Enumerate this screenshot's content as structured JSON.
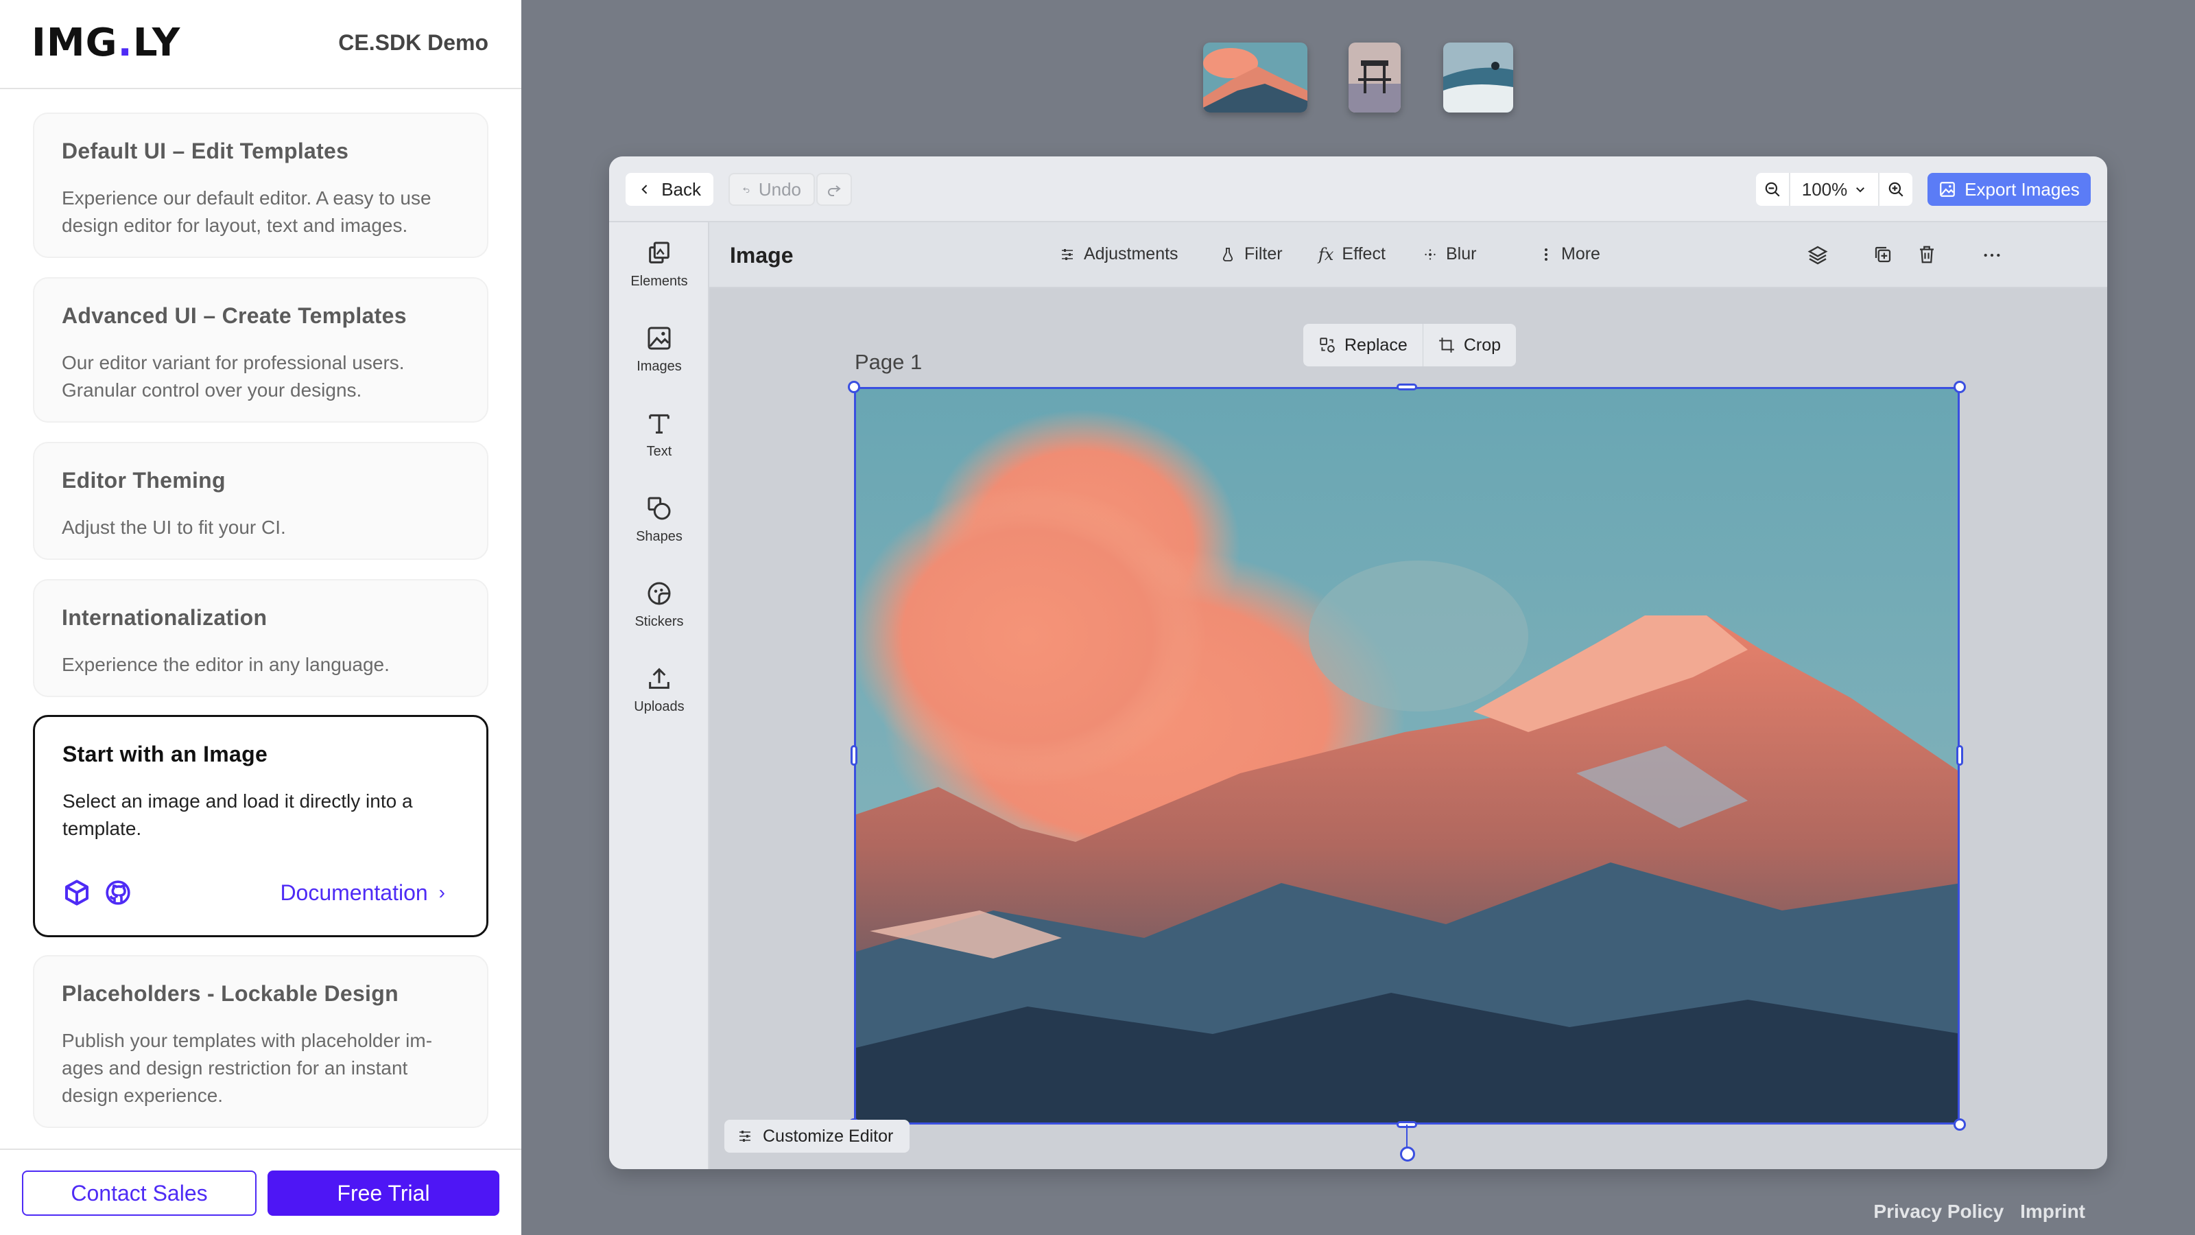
{
  "sidebar": {
    "logo": {
      "left": "IMG",
      "dot": ".",
      "right": "LY"
    },
    "demo_title": "CE.SDK Demo",
    "cards": [
      {
        "title": "Default UI – Edit Templates",
        "desc": "Experience our default editor. A easy to use design editor for layout, text and images."
      },
      {
        "title": "Advanced UI – Create Templates",
        "desc": "Our editor variant for professional users. Granular control over your designs."
      },
      {
        "title": "Editor Theming",
        "desc": "Adjust the UI to fit your CI."
      },
      {
        "title": "Internationalization",
        "desc": "Experience the editor in any language."
      },
      {
        "title": "Start with an Image",
        "desc": "Select an image and load it directly into a template.",
        "doc_link": "Documentation"
      },
      {
        "title": "Placeholders - Lockable Design",
        "desc": "Publish your templates with placeholder im-ages and design restriction for an instant design experience."
      }
    ],
    "footer": {
      "contact": "Contact Sales",
      "trial": "Free Trial"
    }
  },
  "editor": {
    "topbar": {
      "back": "Back",
      "undo": "Undo",
      "zoom": "100%",
      "export": "Export Images"
    },
    "rail": [
      {
        "label": "Elements",
        "icon": "elements-icon"
      },
      {
        "label": "Images",
        "icon": "images-icon"
      },
      {
        "label": "Text",
        "icon": "text-icon"
      },
      {
        "label": "Shapes",
        "icon": "shapes-icon"
      },
      {
        "label": "Stickers",
        "icon": "stickers-icon"
      },
      {
        "label": "Uploads",
        "icon": "uploads-icon"
      }
    ],
    "inspector": {
      "title": "Image",
      "adjustments": "Adjustments",
      "filter": "Filter",
      "effect": "Effect",
      "blur": "Blur",
      "more": "More"
    },
    "canvas_toolbar": {
      "replace": "Replace",
      "crop": "Crop"
    },
    "page_label": "Page 1",
    "customize": "Customize Editor"
  },
  "footer_links": {
    "privacy": "Privacy Policy",
    "imprint": "Imprint"
  },
  "colors": {
    "accent": "#4e16f5",
    "selection": "#3a4fe0",
    "export": "#5b7cf6"
  }
}
